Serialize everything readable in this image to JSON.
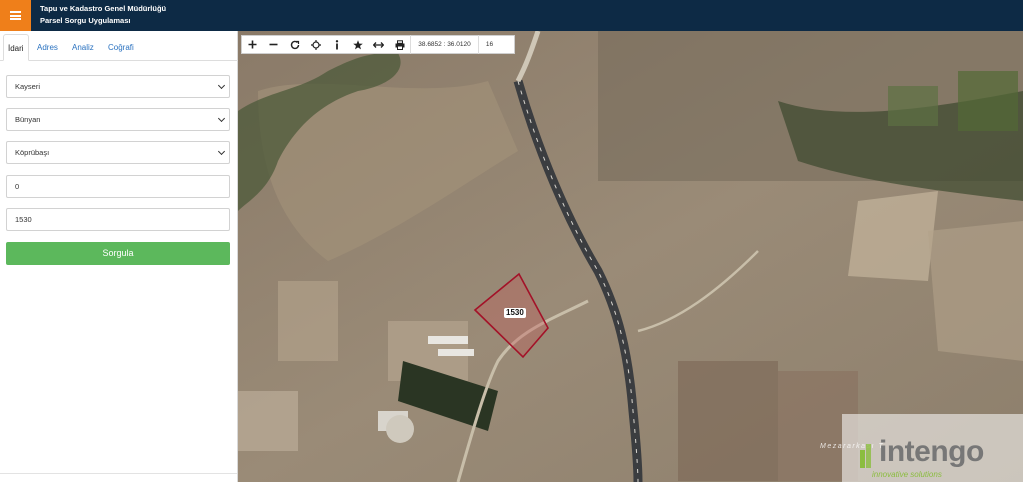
{
  "header": {
    "title_line1": "Tapu ve Kadastro Genel Müdürlüğü",
    "title_line2": "Parsel Sorgu Uygulaması",
    "menu_icon": "hamburger-icon",
    "menu_color": "#ef7f1a",
    "bg_color": "#0d2a45"
  },
  "tabs": [
    {
      "label": "İdari",
      "active": true
    },
    {
      "label": "Adres",
      "active": false
    },
    {
      "label": "Analiz",
      "active": false
    },
    {
      "label": "Coğrafi",
      "active": false
    }
  ],
  "form": {
    "province": "Kayseri",
    "district": "Bünyan",
    "neighborhood": "Köprübaşı",
    "block_no": "0",
    "parcel_no": "1530",
    "submit_label": "Sorgula",
    "submit_color": "#5cb85c"
  },
  "toolbar": {
    "buttons": [
      "zoom-in-icon",
      "zoom-out-icon",
      "refresh-icon",
      "locate-icon",
      "info-icon",
      "favorite-icon",
      "measure-icon",
      "print-icon"
    ],
    "coordinates": "38.6852 : 36.0120",
    "zoom": "16"
  },
  "map": {
    "parcel_label": "1530",
    "place_label": "Mezararkası T",
    "parcel_color": "#b0122c"
  },
  "watermark": {
    "brand": "intengo",
    "tagline": "innovative solutions"
  }
}
